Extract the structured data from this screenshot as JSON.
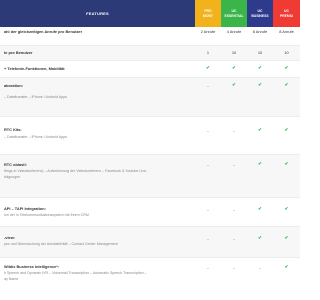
{
  "header": {
    "features_label": "FEATURES",
    "plans": [
      {
        "line1": "PRO",
        "line2": "MONT",
        "color": "#f2b21b"
      },
      {
        "line1": "UC",
        "line2": "ESSENTIAL",
        "color": "#39b54a"
      },
      {
        "line1": "UC",
        "line2": "BUSINESS",
        "color": "#2e3b8c"
      },
      {
        "line1": "UC",
        "line2": "PREMIU",
        "color": "#ef3b33"
      }
    ]
  },
  "rows": [
    {
      "title": "ahl der gleichzeitigen Anrufe pro Benutzer",
      "desc": "",
      "values": [
        "2 Anrufe",
        "4 Anrufe",
        "6 Anrufe",
        "8 Anrufe"
      ]
    },
    {
      "title": "te pro Benutzer",
      "desc": "",
      "values": [
        "1",
        "10",
        "10",
        "10"
      ]
    },
    {
      "title": "+ Telefonie-Funktionen, Mobilität",
      "desc": "",
      "values": [
        "✔",
        "✔",
        "✔",
        "✔"
      ]
    },
    {
      "title": "aboration:",
      "desc": "– Dateitransfer – iPhone / Android Apps",
      "values": [
        "–",
        "✔",
        "✔",
        "✔"
      ]
    },
    {
      "title": "RTC Kits:",
      "desc": "– Dateitransfer – iPhone / Android Apps",
      "values": [
        "–",
        "–",
        "✔",
        "✔"
      ]
    },
    {
      "title": "RTC oblast!:",
      "desc": "ttings in Videokonferenz) – Aufzeichnung der Videokonferenz – Facebook & Youtube Live-\nträgungen",
      "values": [
        "–",
        "–",
        "✔",
        "✔"
      ]
    },
    {
      "title": "API – TAPI Integration:",
      "desc": "ion der in Telekommunikationssystem mit Ihrem CRM",
      "values": [
        "–",
        "–",
        "✔",
        "✔"
      ]
    },
    {
      "title": "-view:",
      "desc": "yse und Überwachung der Anrufaktivität – Contact Center Management",
      "values": [
        "–",
        "–",
        "✔",
        "✔"
      ]
    },
    {
      "title": "Wildix Business Intelligence*:",
      "desc": "h Speech and Dynamic IVR – Voicemail Transcription – Automatic Speech Transcription –\nay Name",
      "values": [
        "–",
        "–",
        "–",
        "✔"
      ]
    }
  ]
}
